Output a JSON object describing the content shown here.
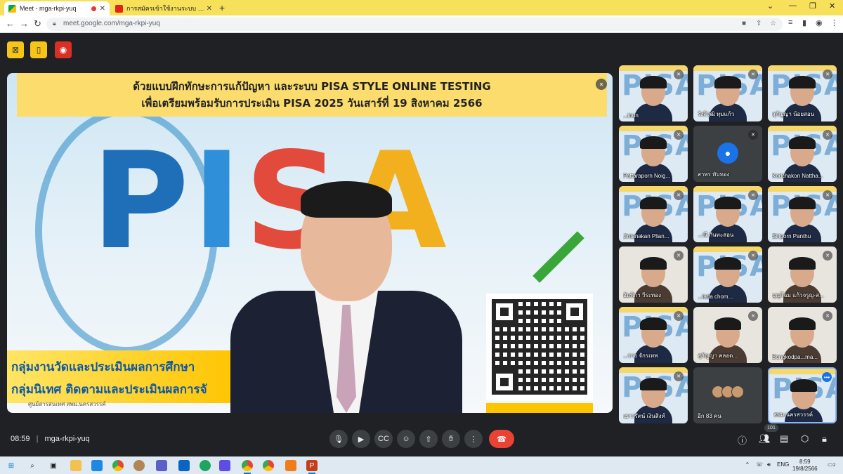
{
  "browser": {
    "tabs": [
      {
        "title": "Meet - mga-rkpi-yuq",
        "active": true,
        "recording": true
      },
      {
        "title": "การสมัครเข้าใช้งานระบบ PISA STYLE",
        "active": false
      }
    ],
    "new_tab": "+",
    "url": "meet.google.com/mga-rkpi-yuq",
    "accent": "#f7e15a"
  },
  "meet_top_buttons": [
    {
      "icon": "captions-off-icon"
    },
    {
      "icon": "door-icon"
    },
    {
      "icon": "record-icon"
    }
  ],
  "main_tile": {
    "banner_line1": "ด้วยแบบฝึกทักษะการแก้ปัญหา และระบบ PISA STYLE ONLINE TESTING",
    "banner_line2": "เพื่อเตรียมพร้อมรับการประเมิน PISA 2025 วันเสาร์ที่ 19 สิงหาคม 2566",
    "logo_letters": [
      "P",
      "I",
      "S",
      "A"
    ],
    "logo_colors": [
      "#1f6fb8",
      "#2f8fd8",
      "#e24b3b",
      "#f2b01e"
    ],
    "left_line1": "กลุ่มงานวัดและประเมินผลการศึกษา",
    "left_line2": "กลุ่มนิเทศ ติดตามและประเมินผลการจั",
    "caption": "ศูนย์สารสนเทศ สพม.นครสวรรค์"
  },
  "participants": [
    {
      "name": "...inun",
      "style": "pisa"
    },
    {
      "name": "รังสิวุฒิ ทุมแก้ว",
      "style": "pisa"
    },
    {
      "name": "สุกัญญา น้อยสอน",
      "style": "pisa"
    },
    {
      "name": "Pattaraporn Noig...",
      "style": "pisa"
    },
    {
      "name": "สาพร ทับทอง",
      "style": "avatar"
    },
    {
      "name": "Kodchakon Nattha...",
      "style": "pisa"
    },
    {
      "name": "Jintanakan Plian...",
      "style": "pisa"
    },
    {
      "name": "...ณี กันทะสอน",
      "style": "pisa"
    },
    {
      "name": "Siriporn Panthu",
      "style": "pisa"
    },
    {
      "name": "อัมพิกา วีระทอง",
      "style": "plain"
    },
    {
      "name": "...lada chom...",
      "style": "pisa"
    },
    {
      "name": "บุญโฉม แก้วจรูญ-ส...",
      "style": "plain"
    },
    {
      "name": "...ราย จักรเทพ",
      "style": "pisa"
    },
    {
      "name": "สุกัญญา คลอด...",
      "style": "plain"
    },
    {
      "name": "Bongkodpa...ma...",
      "style": "plain"
    },
    {
      "name": "เยาวรัตน์ เงินสิงห์",
      "style": "pisa"
    },
    {
      "name": "อีก 83 คน",
      "style": "others"
    },
    {
      "name": "สพม.นครสวรรค์",
      "style": "self"
    }
  ],
  "controls": {
    "time": "08:59",
    "separator": "|",
    "meeting_code": "mga-rkpi-yuq",
    "participant_count": "101",
    "more_dots": "•••"
  },
  "taskbar": {
    "lang": "ENG",
    "time": "8:59",
    "date": "19/8/2566",
    "notifications": "2"
  }
}
